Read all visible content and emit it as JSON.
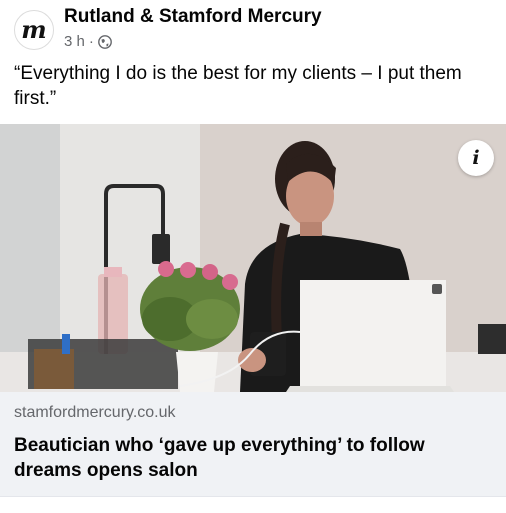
{
  "post": {
    "page_name": "Rutland & Stamford Mercury",
    "avatar_letter": "m",
    "time": "3 h",
    "separator": "·",
    "privacy_icon": "globe-icon",
    "text": "“Everything I do is the best for my clients – I put them first.”",
    "info_icon_label": "i"
  },
  "link": {
    "domain": "stamfordmercury.co.uk",
    "headline": "Beautician who ‘gave up everything’ to follow dreams opens salon"
  }
}
